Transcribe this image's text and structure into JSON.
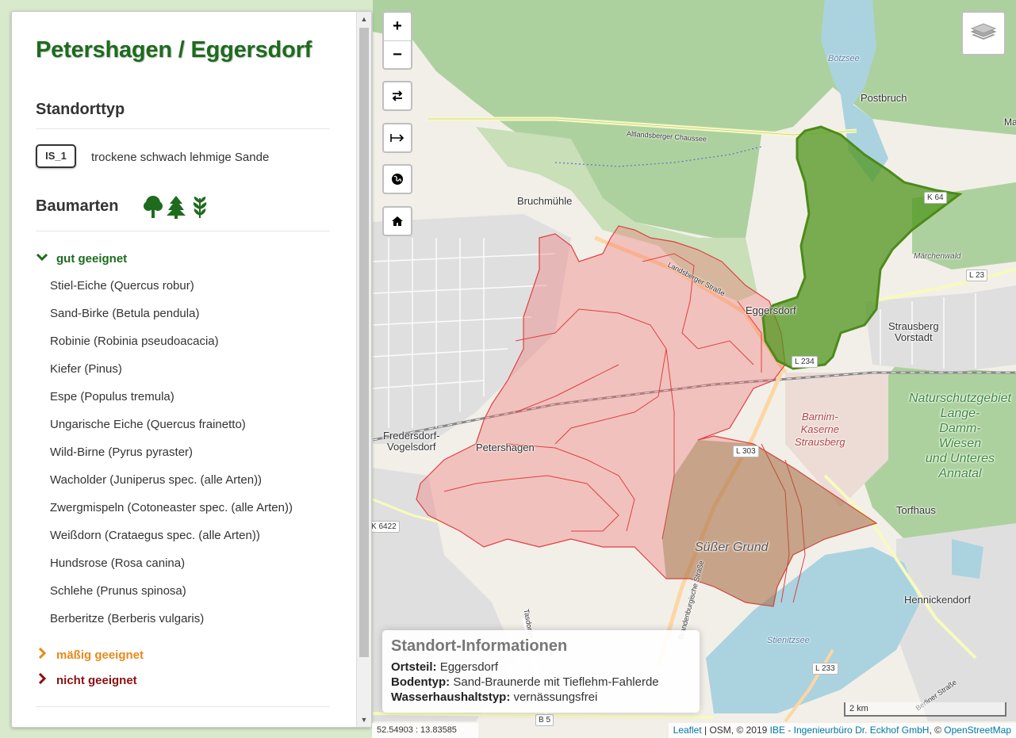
{
  "sidebar": {
    "title": "Petershagen / Eggersdorf",
    "standort_heading": "Standorttyp",
    "standort_code": "IS_1",
    "standort_desc": "trockene schwach lehmige Sande",
    "baumarten_heading": "Baumarten",
    "tree_icons": [
      "deciduous-tree-icon",
      "conifer-tree-icon",
      "shrub-icon"
    ],
    "categories": {
      "gut": {
        "label": "gut geeignet",
        "color": "#1e6b1e",
        "expanded": true
      },
      "maessig": {
        "label": "mäßig geeignet",
        "color": "#e8891a",
        "expanded": false
      },
      "nicht": {
        "label": "nicht geeignet",
        "color": "#8b1010",
        "expanded": false
      }
    },
    "species": [
      "Stiel-Eiche (Quercus robur)",
      "Sand-Birke (Betula pendula)",
      "Robinie (Robinia pseudoacacia)",
      "Kiefer (Pinus)",
      "Espe (Populus tremula)",
      "Ungarische Eiche (Quercus frainetto)",
      "Wild-Birne (Pyrus pyraster)",
      "Wacholder (Juniperus spec. (alle Arten))",
      "Zwergmispeln (Cotoneaster spec. (alle Arten))",
      "Weißdorn (Crataegus spec. (alle Arten))",
      "Hundsrose (Rosa canina)",
      "Schlehe (Prunus spinosa)",
      "Berberitze (Berberis vulgaris)"
    ]
  },
  "controls": {
    "zoom_in": "+",
    "zoom_out": "−"
  },
  "map_labels": {
    "bruchmuehle": "Bruchmühle",
    "eggersdorf": "Eggersdorf",
    "petershagen": "Petershagen",
    "fredersdorf": "Fredersdorf-\nVogelsdorf",
    "postbruch": "Postbruch",
    "strausberg_vorstadt": "Strausberg\nVorstadt",
    "maerchenwald": "Märchenwald",
    "barnim": "Barnim-\nKaserne\nStrausberg",
    "naturschutz": "Naturschutzgebiet\nLange-\nDamm-\nWiesen\nund Unteres\nAnnatal",
    "torfhaus": "Torfhaus",
    "susser_grund": "Süßer Grund",
    "hennickendorf": "Hennickendorf",
    "stienitzsee": "Stienitzsee",
    "bootzsee": "Bötzsee",
    "altlandsberger": "Altlandsberger Chaussee",
    "landsberger": "Landsberger Straße",
    "l23": "L 23",
    "l303": "L 303",
    "l233": "L 233",
    "l234": "L 234",
    "k64": "K 64",
    "k6422": "K 6422",
    "b5": "B 5",
    "ma": "Ma",
    "tasdorfer": "Tasdorfer",
    "berliner": "Berliner Straße",
    "brandenburgische": "Brandenburgische Straße"
  },
  "info": {
    "heading": "Standort-Informationen",
    "ortsteil_label": "Ortsteil:",
    "ortsteil_value": "Eggersdorf",
    "bodentyp_label": "Bodentyp:",
    "bodentyp_value": "Sand-Braunerde mit Tieflehm-Fahlerde",
    "wasser_label": "Wasserhaushaltstyp:",
    "wasser_value": "vernässungsfrei"
  },
  "scale": "2 km",
  "coords": "52.54903 : 13.83585",
  "attribution": {
    "leaflet": "Leaflet",
    "osm": " | OSM, © 2019 ",
    "ibe": "IBE - Ingenieurbüro Dr. Eckhof GmbH",
    "sep": ", © ",
    "openstreetmap": "OpenStreetMap"
  },
  "colors": {
    "title_green": "#1e6b1e",
    "polygon_red": "#e04040",
    "polygon_green": "#4d8a1a",
    "forest": "#add19e"
  }
}
